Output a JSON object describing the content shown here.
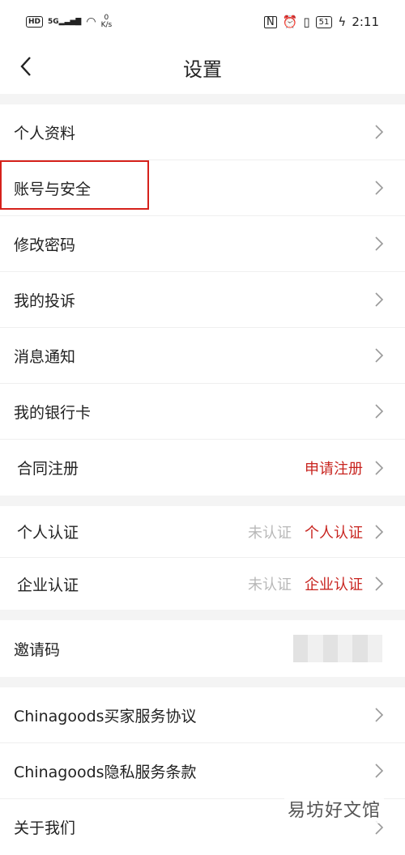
{
  "status_bar": {
    "hd": "HD",
    "signal": "5G",
    "net_speed_value": "0",
    "net_speed_unit": "K/s",
    "battery": "51",
    "time": "2:11"
  },
  "nav": {
    "title": "设置"
  },
  "sections": {
    "s1": [
      "个人资料",
      "账号与安全",
      "修改密码",
      "我的投诉",
      "消息通知",
      "我的银行卡"
    ],
    "contract": {
      "label": "合同注册",
      "action": "申请注册"
    },
    "personal_auth": {
      "label": "个人认证",
      "status": "未认证",
      "action": "个人认证"
    },
    "enterprise_auth": {
      "label": "企业认证",
      "status": "未认证",
      "action": "企业认证"
    },
    "invite": {
      "label": "邀请码"
    },
    "s4": [
      "Chinagoods买家服务协议",
      "Chinagoods隐私服务条款",
      "关于我们"
    ]
  },
  "watermark": "易坊好文馆",
  "colors": {
    "accent": "#c8241f",
    "highlight": "#d6211b",
    "muted": "#b8b8b8"
  }
}
